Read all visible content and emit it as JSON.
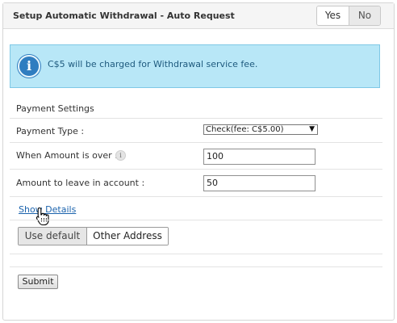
{
  "header": {
    "title": "Setup Automatic Withdrawal - Auto Request",
    "toggle": {
      "yes_label": "Yes",
      "no_label": "No",
      "selected": "Yes"
    }
  },
  "notice": {
    "icon": "info-icon",
    "text": "C$5 will be charged for Withdrawal service fee."
  },
  "section_title": "Payment Settings",
  "form": {
    "payment_type_label": "Payment Type :",
    "payment_type_value": "Check(fee: C$5.00)",
    "amount_over_label": "When Amount is over :",
    "amount_over_value": "100",
    "amount_leave_label": "Amount to leave in account :",
    "amount_leave_value": "50"
  },
  "show_details_link": "Show Details",
  "address_toggle": {
    "default_label": "Use default",
    "other_label": "Other Address",
    "selected": "Use default"
  },
  "submit_label": "Submit",
  "colors": {
    "info_bg": "#b8e7f7",
    "info_icon": "#2f7dc0",
    "link": "#1b63ad"
  }
}
